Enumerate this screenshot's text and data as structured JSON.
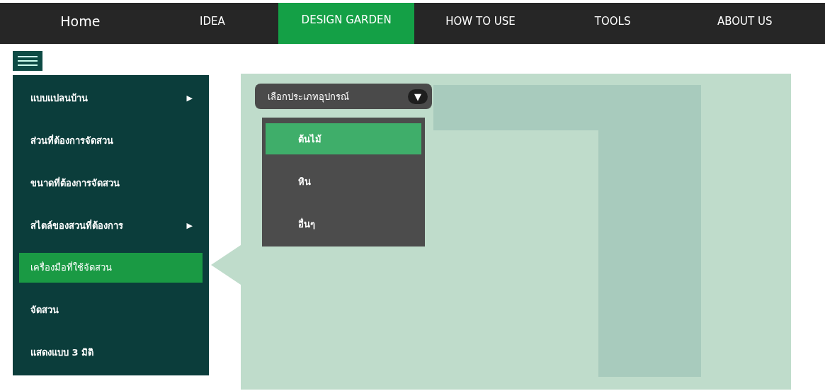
{
  "nav": [
    {
      "label": "Home",
      "selected": false
    },
    {
      "label": "IDEA",
      "selected": false
    },
    {
      "label": "DESIGN GARDEN",
      "selected": true
    },
    {
      "label": "HOW TO USE",
      "selected": false
    },
    {
      "label": "TOOLS",
      "selected": false
    },
    {
      "label": "ABOUT US",
      "selected": false
    }
  ],
  "sidebar": {
    "items": [
      {
        "label": "แบบแปลนบ้าน",
        "arrow": "▶",
        "selected": false
      },
      {
        "label": "ส่วนที่ต้องการจัดสวน",
        "selected": false
      },
      {
        "label": "ขนาดที่ต้องการจัดสวน",
        "selected": false
      },
      {
        "label": "สไตล์ของสวนที่ต้องการ",
        "arrow": "▶",
        "selected": false
      },
      {
        "label": "เครื่องมือที่ใช้จัดสวน",
        "selected": true
      },
      {
        "label": "จัดสวน",
        "selected": false
      },
      {
        "label": "แสดงแบบ 3 มิติ",
        "selected": false
      }
    ]
  },
  "dropdown": {
    "label": "เลือกประเภทอุปกรณ์",
    "caret": "▼",
    "expanded": true,
    "options": [
      {
        "label": "ต้นไม้",
        "selected": true
      },
      {
        "label": "หิน",
        "selected": false
      },
      {
        "label": "อื่นๆ",
        "selected": false
      }
    ]
  }
}
